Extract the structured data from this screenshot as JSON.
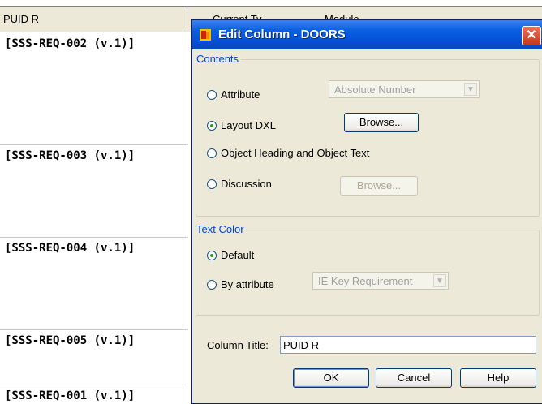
{
  "grid": {
    "column_header": "PUID R",
    "partial_headers": [
      "Current Ty",
      "Module"
    ],
    "rows": [
      "[SSS-REQ-002 (v.1)]",
      "[SSS-REQ-003 (v.1)]",
      "[SSS-REQ-004 (v.1)]",
      "[SSS-REQ-005 (v.1)]",
      "[SSS-REQ-001 (v.1)]"
    ]
  },
  "dialog": {
    "title": "Edit Column - DOORS",
    "close_glyph": "✕",
    "contents": {
      "group_label": "Contents",
      "attribute": {
        "label": "Attribute",
        "selected": false,
        "combo_value": "Absolute Number"
      },
      "layout_dxl": {
        "label": "Layout DXL",
        "selected": true,
        "browse_label": "Browse..."
      },
      "object_heading": {
        "label": "Object Heading and Object Text",
        "selected": false
      },
      "discussion": {
        "label": "Discussion",
        "selected": false,
        "browse_label": "Browse..."
      }
    },
    "text_color": {
      "group_label": "Text Color",
      "default": {
        "label": "Default",
        "selected": true
      },
      "by_attribute": {
        "label": "By attribute",
        "selected": false,
        "combo_value": "IE Key Requirement"
      }
    },
    "column_title": {
      "label": "Column Title:",
      "value": "PUID R"
    },
    "buttons": {
      "ok": "OK",
      "cancel": "Cancel",
      "help": "Help"
    },
    "colors": {
      "titlebar": "#0550d8",
      "group_label": "#0046d5",
      "dialog_bg": "#ece9d8"
    }
  }
}
